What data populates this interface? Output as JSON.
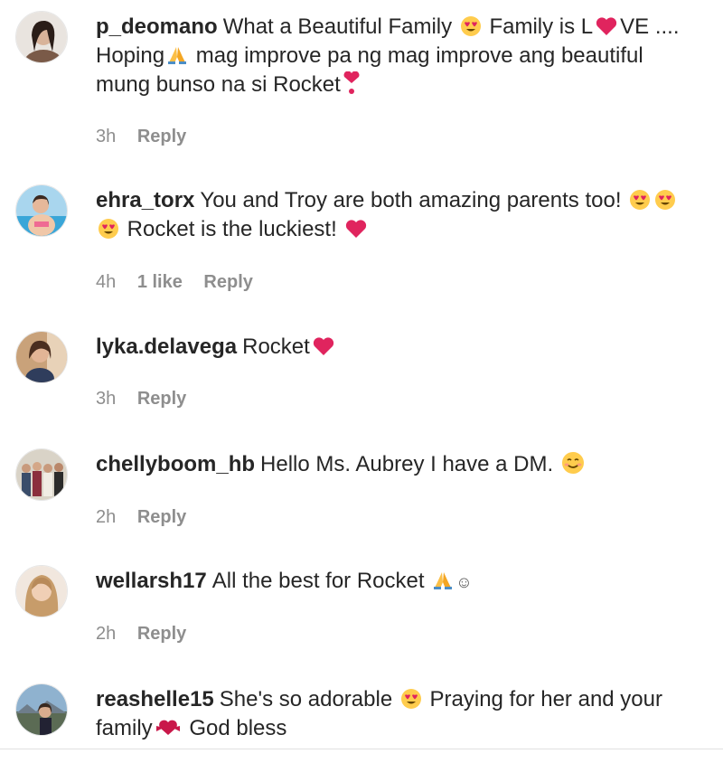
{
  "colors": {
    "text": "#262626",
    "meta": "#8e8e8e",
    "heart": "#e0245e",
    "emoji_face": "#ffcc4d"
  },
  "comments": [
    {
      "username": "p_deomano",
      "text_parts": [
        "What a Beautiful Family",
        "Family is L",
        "VE ....",
        "Hoping",
        "mag improve pa ng mag improve ang beautiful",
        "mung bunso na si Rocket"
      ],
      "time": "3h",
      "reply": "Reply"
    },
    {
      "username": "ehra_torx",
      "text_parts": [
        "You and Troy are both amazing parents too!",
        "Rocket is the luckiest!"
      ],
      "time": "4h",
      "likes": "1 like",
      "reply": "Reply"
    },
    {
      "username": "lyka.delavega",
      "text_parts": [
        "Rocket"
      ],
      "time": "3h",
      "reply": "Reply"
    },
    {
      "username": "chellyboom_hb",
      "text_parts": [
        "Hello Ms. Aubrey I have a DM."
      ],
      "time": "2h",
      "reply": "Reply"
    },
    {
      "username": "wellarsh17",
      "text_parts": [
        "All the best for Rocket",
        "☺"
      ],
      "time": "2h",
      "reply": "Reply"
    },
    {
      "username": "reashelle15",
      "text_parts": [
        "She's so adorable",
        "Praying for her and your",
        "family",
        "God bless"
      ]
    }
  ]
}
